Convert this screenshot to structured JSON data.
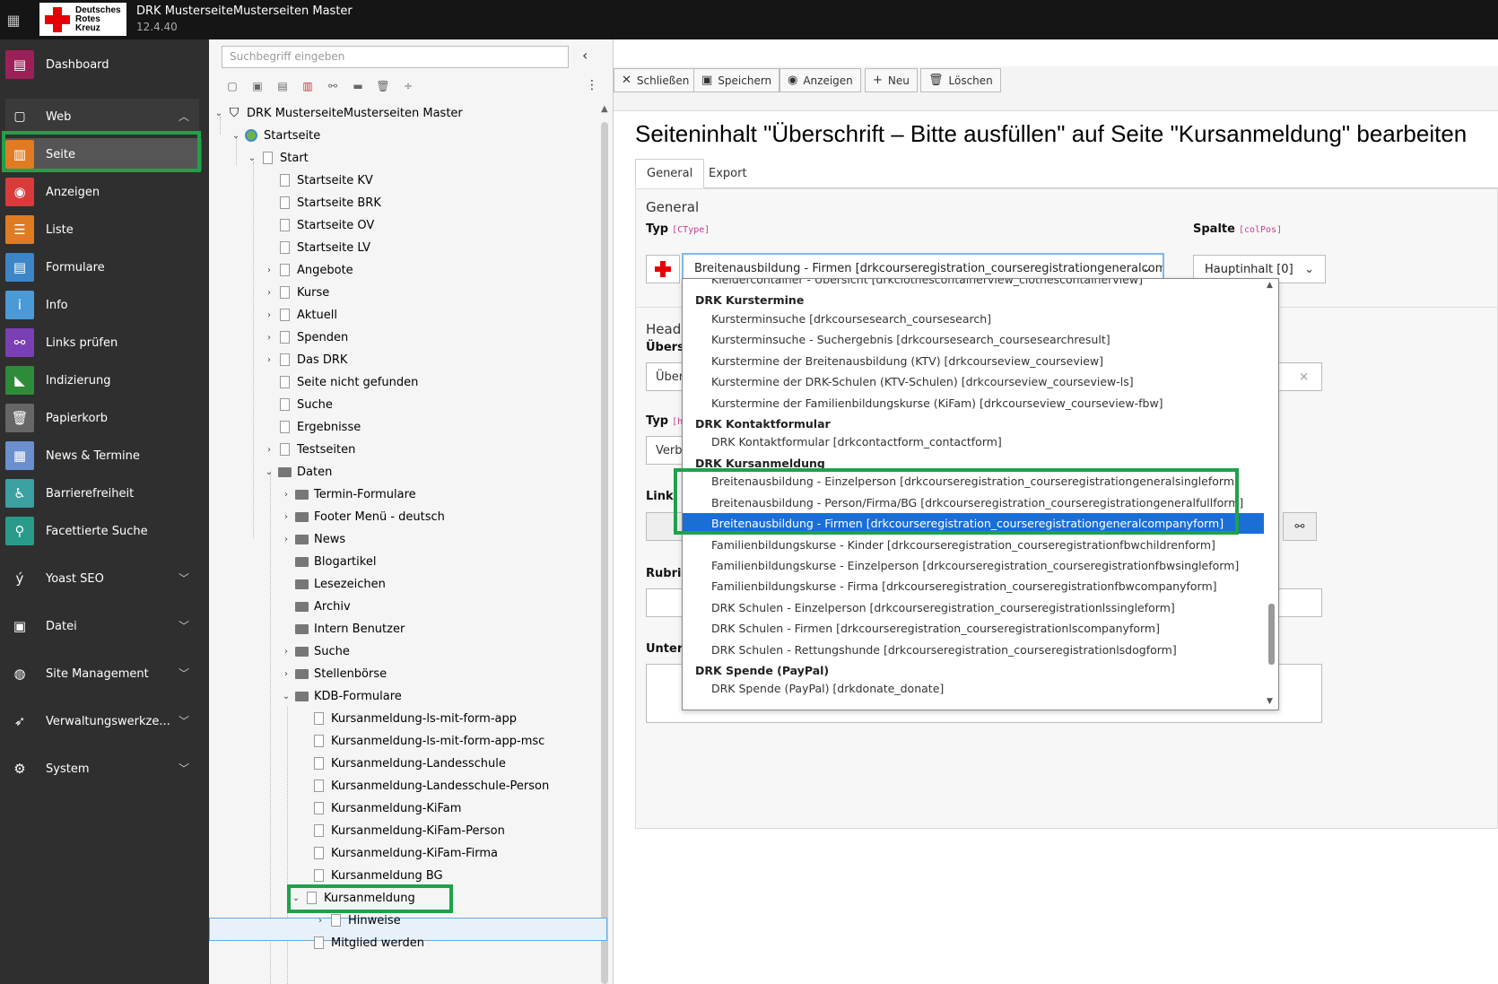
{
  "topbar": {
    "grid_icon": "grid-icon",
    "logo_text": "Deutsches Rotes Kreuz",
    "site_title": "DRK MusterseiteMusterseiten Master",
    "version": "12.4.40"
  },
  "modules": {
    "dashboard": "Dashboard",
    "web": "Web",
    "seite": "Seite",
    "anzeigen": "Anzeigen",
    "liste": "Liste",
    "formulare": "Formulare",
    "info": "Info",
    "links": "Links prüfen",
    "indizierung": "Indizierung",
    "papierkorb": "Papierkorb",
    "news": "News & Termine",
    "barriere": "Barrierefreiheit",
    "facettierte": "Facettierte Suche",
    "yoast": "Yoast SEO",
    "datei": "Datei",
    "site": "Site Management",
    "verwaltung": "Verwaltungswerkze...",
    "system": "System"
  },
  "tree": {
    "search_placeholder": "Suchbegriff eingeben",
    "root": "DRK MusterseiteMusterseiten Master",
    "nodes": [
      "Startseite",
      "Start",
      "Startseite KV",
      "Startseite BRK",
      "Startseite OV",
      "Startseite LV",
      "Angebote",
      "Kurse",
      "Aktuell",
      "Spenden",
      "Das DRK",
      "Seite nicht gefunden",
      "Suche",
      "Ergebnisse",
      "Testseiten",
      "Daten",
      "Termin-Formulare",
      "Footer Menü - deutsch",
      "News",
      "Blogartikel",
      "Lesezeichen",
      "Archiv",
      "Intern Benutzer",
      "Suche",
      "Stellenbörse",
      "KDB-Formulare",
      "Kursanmeldung-ls-mit-form-app",
      "Kursanmeldung-ls-mit-form-app-msc",
      "Kursanmeldung-Landesschule",
      "Kursanmeldung-Landesschule-Person",
      "Kursanmeldung-KiFam",
      "Kursanmeldung-KiFam-Person",
      "Kursanmeldung-KiFam-Firma",
      "Kursanmeldung BG",
      "Kursanmeldung",
      "Hinweise",
      "Mitglied werden"
    ]
  },
  "docheader": {
    "close": "Schließen",
    "save": "Speichern",
    "view": "Anzeigen",
    "new": "Neu",
    "delete": "Löschen"
  },
  "content": {
    "title": "Seiteninhalt \"Überschrift – Bitte ausfüllen\" auf Seite \"Kursanmeldung\" bearbeiten",
    "tabs": [
      "General",
      "Export"
    ],
    "section_general": "General",
    "typ_label": "Typ",
    "typ_code": "[CType]",
    "spalte_label": "Spalte",
    "spalte_code": "[colPos]",
    "ctype_value": "Breitenausbildung - Firmen [drkcourseregistration_courseregistrationgeneralcompanyform]",
    "colpos_value": "Hauptinhalt [0]",
    "header_section": "Heade",
    "ueberschrift_label": "Übersc",
    "ueber_value": "Über",
    "typ2_label": "Typ",
    "typ2_code": "[h",
    "verb_value": "Verb",
    "link_label": "Link:",
    "rubrik_label": "Rubrik",
    "unteri_label": "Unteri",
    "clear_icon": "×"
  },
  "dropdown": {
    "items": [
      {
        "kind": "opt",
        "text": "Kleidercontainer - Übersicht [drkclothescontainerview_clothescontainerview]"
      },
      {
        "kind": "grp",
        "text": "DRK Kurstermine"
      },
      {
        "kind": "opt",
        "text": "Kursterminsuche [drkcoursesearch_coursesearch]"
      },
      {
        "kind": "opt",
        "text": "Kursterminsuche - Suchergebnis [drkcoursesearch_coursesearchresult]"
      },
      {
        "kind": "opt",
        "text": "Kurstermine der Breitenausbildung (KTV) [drkcourseview_courseview]"
      },
      {
        "kind": "opt",
        "text": "Kurstermine der DRK-Schulen (KTV-Schulen) [drkcourseview_courseview-ls]"
      },
      {
        "kind": "opt",
        "text": "Kurstermine der Familienbildungskurse (KiFam) [drkcourseview_courseview-fbw]"
      },
      {
        "kind": "grp",
        "text": "DRK Kontaktformular"
      },
      {
        "kind": "opt",
        "text": "DRK Kontaktformular [drkcontactform_contactform]"
      },
      {
        "kind": "grp",
        "text": "DRK Kursanmeldung"
      },
      {
        "kind": "opt",
        "text": "Breitenausbildung - Einzelperson [drkcourseregistration_courseregistrationgeneralsingleform]"
      },
      {
        "kind": "opt",
        "text": "Breitenausbildung - Person/Firma/BG [drkcourseregistration_courseregistrationgeneralfullform]"
      },
      {
        "kind": "sel",
        "text": "Breitenausbildung - Firmen [drkcourseregistration_courseregistrationgeneralcompanyform]"
      },
      {
        "kind": "opt",
        "text": "Familienbildungskurse - Kinder [drkcourseregistration_courseregistrationfbwchildrenform]"
      },
      {
        "kind": "opt",
        "text": "Familienbildungskurse - Einzelperson [drkcourseregistration_courseregistrationfbwsingleform]"
      },
      {
        "kind": "opt",
        "text": "Familienbildungskurse - Firma [drkcourseregistration_courseregistrationfbwcompanyform]"
      },
      {
        "kind": "opt",
        "text": "DRK Schulen - Einzelperson [drkcourseregistration_courseregistrationlssingleform]"
      },
      {
        "kind": "opt",
        "text": "DRK Schulen - Firmen [drkcourseregistration_courseregistrationlscompanyform]"
      },
      {
        "kind": "opt",
        "text": "DRK Schulen - Rettungshunde [drkcourseregistration_courseregistrationlsdogform]"
      },
      {
        "kind": "grp",
        "text": "DRK Spende (PayPal)"
      },
      {
        "kind": "opt",
        "text": "DRK Spende (PayPal) [drkdonate_donate]"
      }
    ]
  },
  "colors": {
    "highlight_green": "#1fa14a",
    "selected_blue": "#1a6fd6",
    "drk_red": "#e60005"
  }
}
